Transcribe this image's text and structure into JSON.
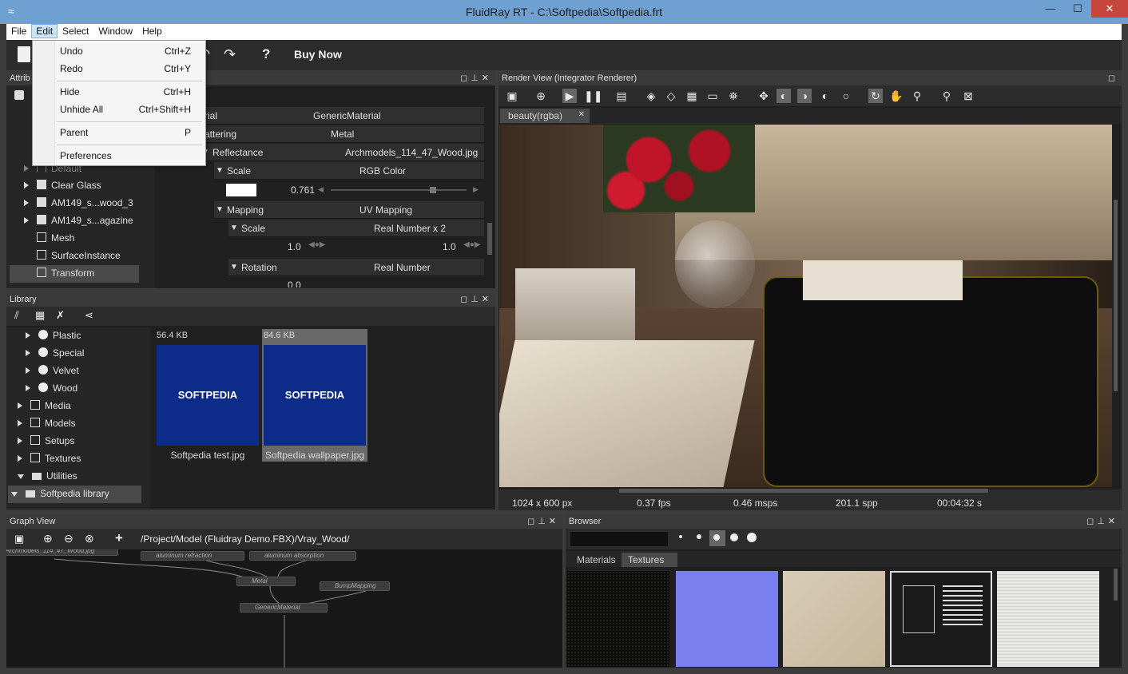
{
  "window": {
    "title": "FluidRay RT - C:\\Softpedia\\Softpedia.frt",
    "minimize": "—",
    "maximize": "☐",
    "close": "✕"
  },
  "menu": {
    "file": "File",
    "edit": "Edit",
    "select": "Select",
    "window": "Window",
    "help": "Help"
  },
  "edit_menu": {
    "undo": "Undo",
    "undo_sc": "Ctrl+Z",
    "redo": "Redo",
    "redo_sc": "Ctrl+Y",
    "hide": "Hide",
    "hide_sc": "Ctrl+H",
    "unhide_all": "Unhide All",
    "unhide_all_sc": "Ctrl+Shift+H",
    "parent": "Parent",
    "parent_sc": "P",
    "preferences": "Preferences"
  },
  "toolbar": {
    "buy_now": "Buy Now",
    "help": "?"
  },
  "attributes": {
    "title": "Attrib",
    "tree": [
      "Default",
      "Clear Glass",
      "AM149_s...wood_3",
      "AM149_s...agazine",
      "Mesh",
      "SurfaceInstance",
      "Transform"
    ],
    "props": {
      "material_label": "rial",
      "material_value": "GenericMaterial",
      "scattering_label": "attering",
      "scattering_value": "Metal",
      "reflectance_label": "Reflectance",
      "reflectance_value": "Archmodels_114_47_Wood.jpg",
      "scale_label": "Scale",
      "scale_value": "RGB Color",
      "scale_num": "0.761",
      "mapping_label": "Mapping",
      "mapping_value": "UV Mapping",
      "scale2_label": "Scale",
      "scale2_value": "Real Number x 2",
      "scale2_a": "1.0",
      "scale2_b": "1.0",
      "rotation_label": "Rotation",
      "rotation_value": "Real Number",
      "rotation_num": "0.0"
    }
  },
  "library": {
    "title": "Library",
    "tree": [
      {
        "label": "Plastic",
        "indent": 1,
        "open": false
      },
      {
        "label": "Special",
        "indent": 1,
        "open": false
      },
      {
        "label": "Velvet",
        "indent": 1,
        "open": false
      },
      {
        "label": "Wood",
        "indent": 1,
        "open": false
      },
      {
        "label": "Media",
        "indent": 0,
        "open": false
      },
      {
        "label": "Models",
        "indent": 0,
        "open": false
      },
      {
        "label": "Setups",
        "indent": 0,
        "open": false
      },
      {
        "label": "Textures",
        "indent": 0,
        "open": false
      },
      {
        "label": "Utilities",
        "indent": 0,
        "open": true
      },
      {
        "label": "Softpedia library",
        "indent": 0,
        "open": true
      }
    ],
    "files": [
      {
        "size": "56.4 KB",
        "name": "Softpedia test.jpg",
        "logo": "SOFTPEDIA"
      },
      {
        "size": "84.6 KB",
        "name": "Softpedia wallpaper.jpg",
        "logo": "SOFTPEDIA"
      }
    ]
  },
  "render": {
    "title": "Render View (Integrator Renderer)",
    "tab": "beauty(rgba)",
    "resolution": "1024 x 600 px",
    "fps": "0.37 fps",
    "msps": "0.46 msps",
    "spp": "201.1 spp",
    "time": "00:04:32 s"
  },
  "graph": {
    "title": "Graph View",
    "path": "/Project/Model (Fluidray Demo.FBX)/Vray_Wood/",
    "nodes": [
      "aluminum refraction",
      "aluminum absorption",
      "Metal",
      "BumpMapping",
      "GenericMaterial",
      "Archmodels_114_47_Wood.jpg"
    ]
  },
  "browser": {
    "title": "Browser",
    "tabs": [
      "Materials",
      "Textures"
    ]
  },
  "colors": {
    "title_bar": "#6fa0d2",
    "panel_bg": "#202020",
    "accent": "#1e56b8"
  }
}
